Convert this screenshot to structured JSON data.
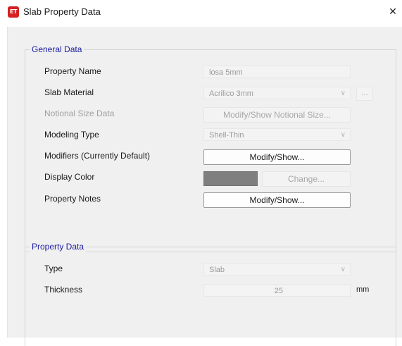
{
  "window": {
    "app_icon_text": "ET",
    "title": "Slab Property Data",
    "close_glyph": "✕"
  },
  "general_data": {
    "caption": "General Data",
    "property_name": {
      "label": "Property Name",
      "value": "losa 5mm"
    },
    "slab_material": {
      "label": "Slab Material",
      "value": "Acrilico 3mm",
      "ellipsis_label": "..."
    },
    "notional_size": {
      "label": "Notional Size Data",
      "button": "Modify/Show Notional Size..."
    },
    "modeling_type": {
      "label": "Modeling Type",
      "value": "Shell-Thin"
    },
    "modifiers": {
      "label": "Modifiers (Currently Default)",
      "button": "Modify/Show..."
    },
    "display_color": {
      "label": "Display Color",
      "color": "#7f7f7f",
      "button": "Change..."
    },
    "property_notes": {
      "label": "Property Notes",
      "button": "Modify/Show..."
    }
  },
  "property_data": {
    "caption": "Property Data",
    "type": {
      "label": "Type",
      "value": "Slab"
    },
    "thickness": {
      "label": "Thickness",
      "value": "25",
      "unit": "mm"
    }
  },
  "icons": {
    "chevron": "∨"
  }
}
